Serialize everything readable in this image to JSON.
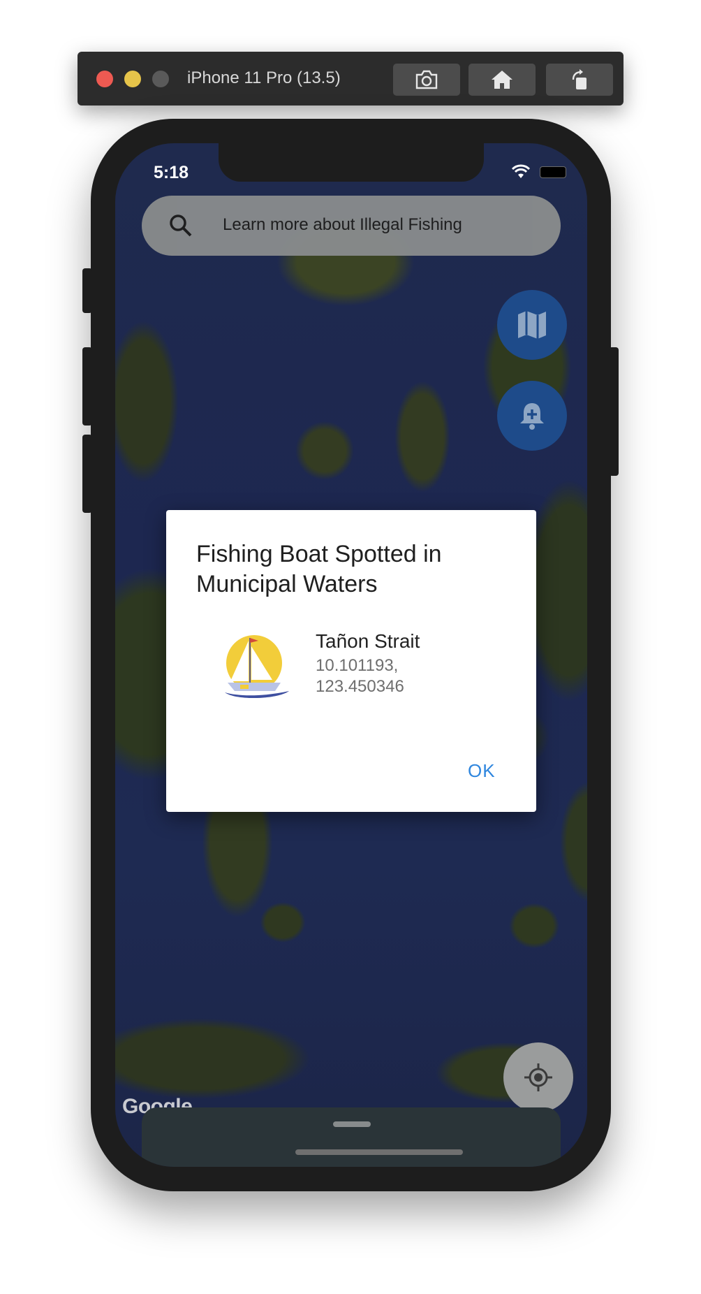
{
  "simulator": {
    "title": "iPhone 11 Pro (13.5)",
    "buttons": [
      "screenshot-icon",
      "home-icon",
      "rotate-icon"
    ]
  },
  "status_bar": {
    "time": "5:18"
  },
  "search": {
    "placeholder": "Learn more about Illegal Fishing"
  },
  "map": {
    "attribution": "Google"
  },
  "dialog": {
    "title": "Fishing Boat Spotted in Municipal Waters",
    "location_name": "Tañon Strait",
    "coordinates_lat": "10.101193,",
    "coordinates_lng": "123.450346",
    "ok_label": "OK"
  },
  "colors": {
    "fab_blue": "#1e4b8a",
    "ok_blue": "#2f86de",
    "boat_yellow": "#f2cd3a"
  }
}
